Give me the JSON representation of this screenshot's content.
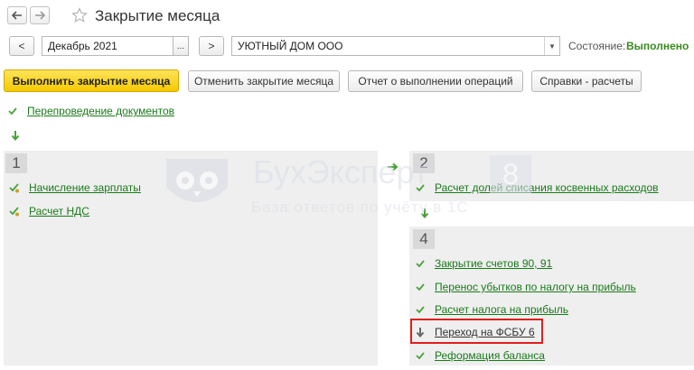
{
  "header": {
    "title": "Закрытие месяца",
    "back_icon": "arrow-left-icon",
    "forward_icon": "arrow-right-icon",
    "favorite_icon": "star-icon"
  },
  "period_bar": {
    "prev": "<",
    "period": "Декабрь 2021",
    "ellipsis": "...",
    "next": ">",
    "organization": "УЮТНЫЙ ДОМ ООО",
    "state_label": "Состояние:",
    "state_value": "Выполнено"
  },
  "toolbar": {
    "run": "Выполнить закрытие месяца",
    "cancel": "Отменить закрытие месяца",
    "report": "Отчет о выполнении операций",
    "refs": "Справки - расчеты"
  },
  "reposting": {
    "label": "Перепроведение документов"
  },
  "section1": {
    "number": "1",
    "items": [
      {
        "label": "Начисление зарплаты"
      },
      {
        "label": "Расчет НДС"
      }
    ]
  },
  "section2": {
    "number": "2",
    "items": [
      {
        "label": "Расчет долей списания косвенных расходов"
      }
    ]
  },
  "section4": {
    "number": "4",
    "items": [
      {
        "label": "Закрытие счетов 90, 91"
      },
      {
        "label": "Перенос убытков по налогу на прибыль"
      },
      {
        "label": "Расчет налога на прибыль"
      },
      {
        "label": "Переход на ФСБУ 6"
      },
      {
        "label": "Реформация баланса"
      }
    ]
  },
  "watermark": {
    "brand": "БухЭксперт",
    "digit": "8",
    "tagline": "База ответов по учёту в 1С"
  },
  "colors": {
    "accent_green": "#4aa23a",
    "link_green": "#1a7a1a",
    "highlight_red": "#e21d1d",
    "primary_yellow": "#f5c900",
    "state_green": "#3a8a1f"
  }
}
